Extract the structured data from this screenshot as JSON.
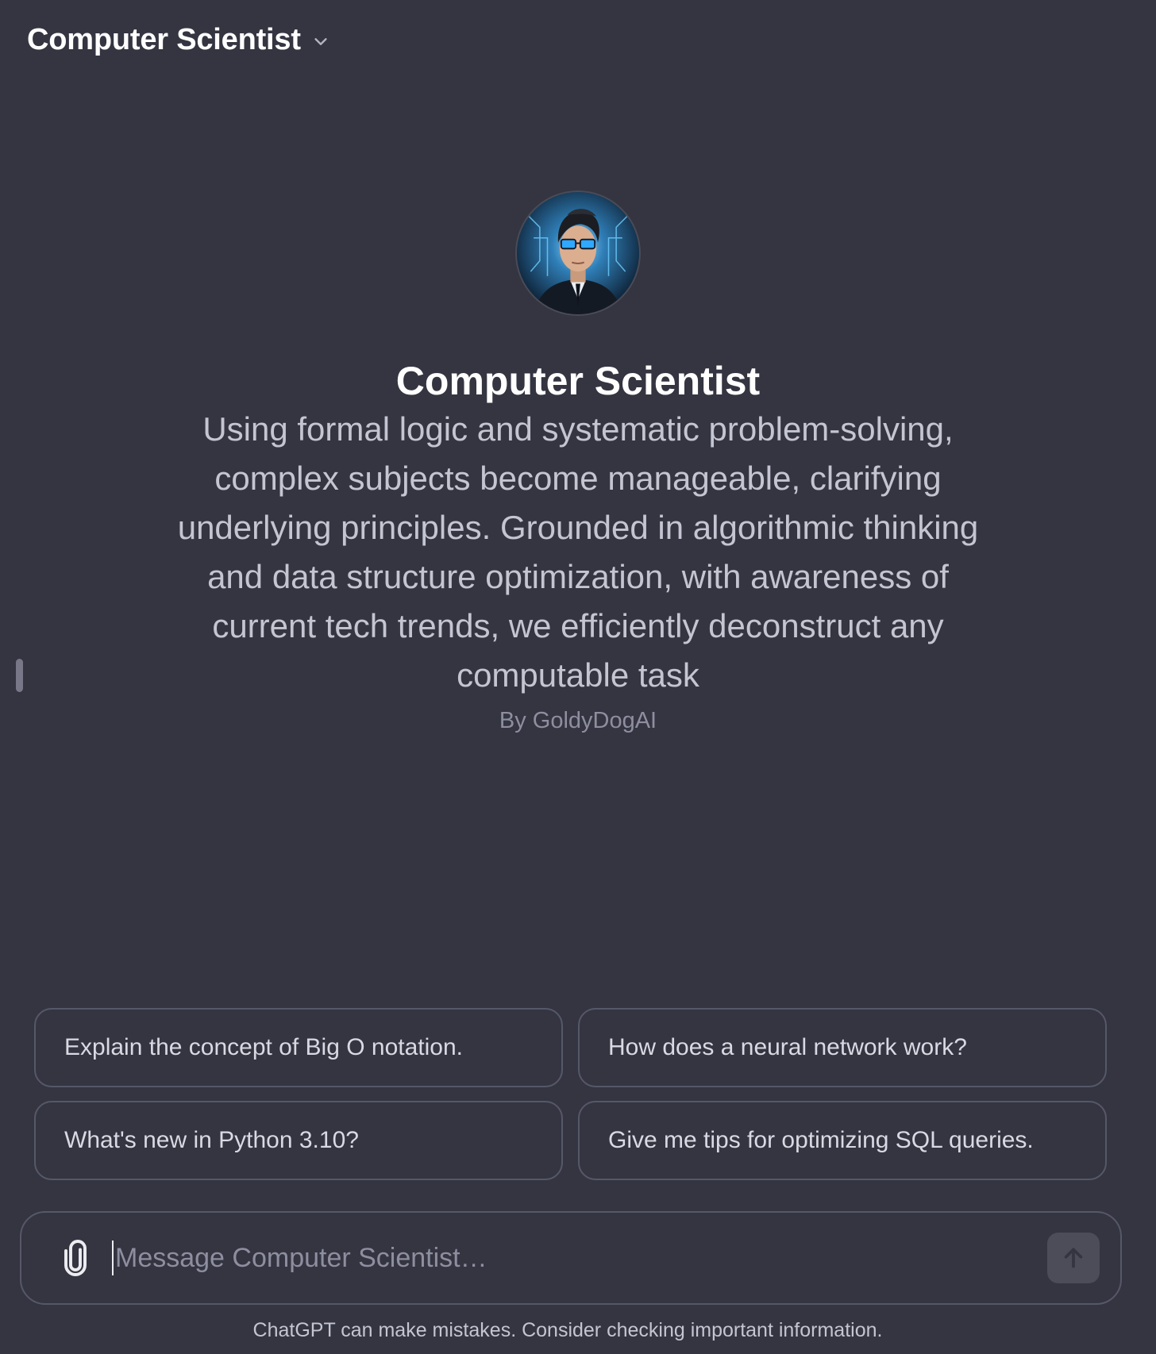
{
  "header": {
    "title": "Computer Scientist",
    "dropdown_icon": "chevron-down-icon"
  },
  "hero": {
    "avatar_icon": "avatar-image",
    "name": "Computer Scientist",
    "description": "Using formal logic and systematic problem-solving, complex subjects become manageable, clarifying underlying principles. Grounded in algorithmic thinking and data structure optimization, with awareness of current tech trends, we efficiently deconstruct any computable task",
    "author": "By GoldyDogAI"
  },
  "suggestions": [
    {
      "label": "Explain the concept of Big O notation."
    },
    {
      "label": "How does a neural network work?"
    },
    {
      "label": "What's new in Python 3.10?"
    },
    {
      "label": "Give me tips for optimizing SQL queries."
    }
  ],
  "composer": {
    "placeholder": "Message Computer Scientist…",
    "value": "",
    "attach_icon": "paperclip-icon",
    "send_icon": "arrow-up-icon"
  },
  "footer": {
    "disclaimer": "ChatGPT can make mistakes. Consider checking important information."
  },
  "colors": {
    "background": "#343541",
    "border": "#565869",
    "muted_text": "#8e8ea0",
    "send_button_bg": "#4c4d58",
    "avatar_glow": "#4fb7ff"
  }
}
